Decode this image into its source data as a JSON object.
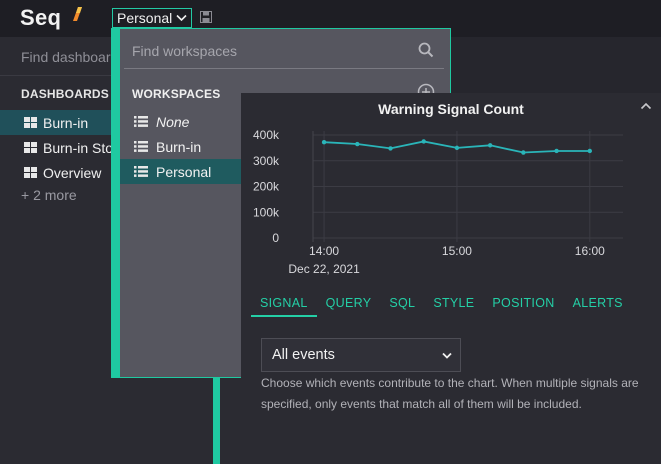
{
  "app": {
    "logo": "Seq",
    "workspace_button": "Personal",
    "colors": {
      "accent": "#1fc9a1",
      "link": "#24cfa6",
      "selected": "#1f5b5f",
      "series": "#2ab5b9"
    }
  },
  "sidebar": {
    "search_placeholder": "Find dashboards",
    "heading": "DASHBOARDS",
    "items": [
      {
        "label": "Burn-in",
        "icon": "dashboard-grid-icon",
        "active": true
      },
      {
        "label": "Burn-in Stories",
        "icon": "dashboard-grid-icon",
        "active": false
      },
      {
        "label": "Overview",
        "icon": "dashboard-grid-icon",
        "active": false
      }
    ],
    "more_label": "+ 2 more"
  },
  "workspace_dropdown": {
    "search_placeholder": "Find workspaces",
    "heading": "WORKSPACES",
    "items": [
      {
        "label": "None",
        "icon": "list-icon",
        "italic": true,
        "selected": false
      },
      {
        "label": "Burn-in",
        "icon": "list-icon",
        "italic": false,
        "selected": false
      },
      {
        "label": "Personal",
        "icon": "list-icon",
        "italic": false,
        "selected": true
      }
    ]
  },
  "panel": {
    "tabs": [
      {
        "label": "SIGNAL",
        "active": true
      },
      {
        "label": "QUERY",
        "active": false
      },
      {
        "label": "SQL",
        "active": false
      },
      {
        "label": "STYLE",
        "active": false
      },
      {
        "label": "POSITION",
        "active": false
      },
      {
        "label": "ALERTS",
        "active": false
      }
    ],
    "select_value": "All events",
    "help_text": "Choose which events contribute to the chart. When multiple signals are specified, only events that match all of them will be included."
  },
  "chart_data": {
    "type": "line",
    "title": "Warning Signal Count",
    "xlabel": "",
    "ylabel": "",
    "x_ticks": [
      "14:00",
      "15:00",
      "16:00"
    ],
    "x_date_label": "Dec 22, 2021",
    "y_ticks": [
      "0",
      "100k",
      "200k",
      "300k",
      "400k"
    ],
    "ylim": [
      0,
      400000
    ],
    "xlim": [
      "13:55",
      "16:15"
    ],
    "grid": true,
    "series": [
      {
        "x": [
          "14:00",
          "14:15",
          "14:30",
          "14:45",
          "15:00",
          "15:15",
          "15:30",
          "15:45",
          "16:00"
        ],
        "y": [
          372000,
          365000,
          348000,
          375000,
          350000,
          360000,
          332000,
          338000,
          338000
        ]
      }
    ]
  }
}
